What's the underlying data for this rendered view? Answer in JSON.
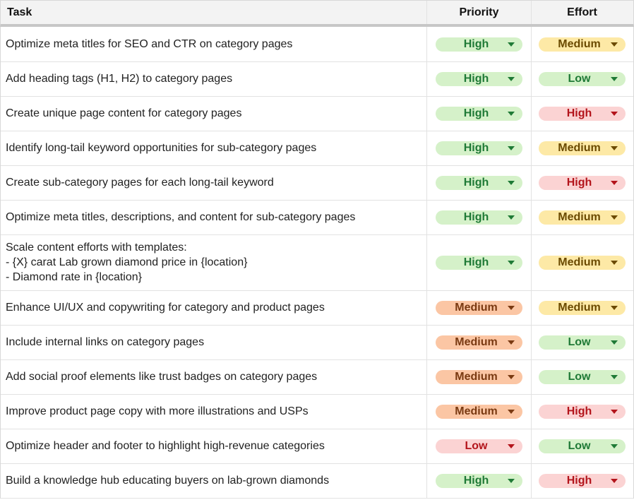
{
  "columns": {
    "task": "Task",
    "priority": "Priority",
    "effort": "Effort"
  },
  "colors": {
    "green_bg": "#d5f1c9",
    "green_fg": "#1f7a36",
    "yellow_bg": "#fde9a6",
    "yellow_fg": "#6b4a00",
    "orange_bg": "#fbc6a4",
    "orange_fg": "#7a3a12",
    "pink_bg": "#fbd3d3",
    "pink_fg": "#b3141b"
  },
  "rows": [
    {
      "task": "Optimize meta titles for SEO and CTR on category pages",
      "priority": "High",
      "effort": "Medium"
    },
    {
      "task": "Add heading tags (H1, H2) to category pages",
      "priority": "High",
      "effort": "Low"
    },
    {
      "task": "Create unique page content for category pages",
      "priority": "High",
      "effort": "High"
    },
    {
      "task": "Identify long-tail keyword opportunities for sub-category pages",
      "priority": "High",
      "effort": "Medium"
    },
    {
      "task": "Create sub-category pages for each long-tail keyword",
      "priority": "High",
      "effort": "High"
    },
    {
      "task": "Optimize meta titles, descriptions, and content for sub-category pages",
      "priority": "High",
      "effort": "Medium"
    },
    {
      "task": "Scale content efforts with templates:\n- {X} carat Lab grown diamond price in {location}\n- Diamond rate in {location}",
      "priority": "High",
      "effort": "Medium"
    },
    {
      "task": "Enhance UI/UX and copywriting for category and product pages",
      "priority": "Medium",
      "effort": "Medium"
    },
    {
      "task": "Include internal links on category pages",
      "priority": "Medium",
      "effort": "Low"
    },
    {
      "task": "Add social proof elements like trust badges on category pages",
      "priority": "Medium",
      "effort": "Low"
    },
    {
      "task": "Improve product page copy with more illustrations and USPs",
      "priority": "Medium",
      "effort": "High"
    },
    {
      "task": "Optimize header and footer to highlight high-revenue categories",
      "priority": "Low",
      "effort": "Low"
    },
    {
      "task": "Build a knowledge hub educating buyers on lab-grown diamonds",
      "priority": "High",
      "effort": "High"
    }
  ]
}
